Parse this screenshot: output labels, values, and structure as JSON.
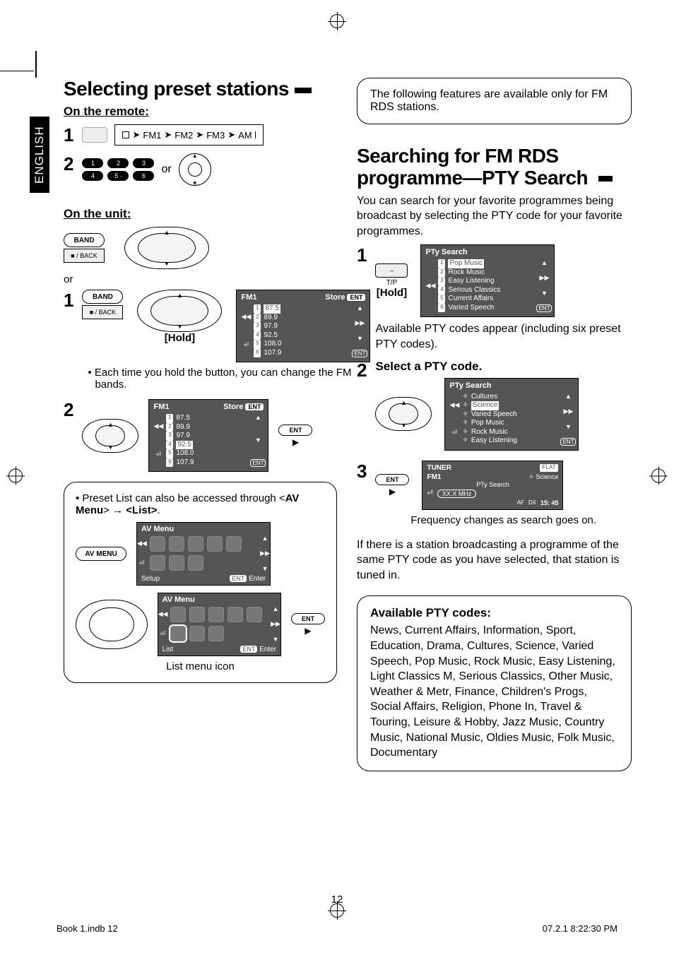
{
  "language_tab": "ENGLISH",
  "page_number": "12",
  "footer_left": "Book 1.indb   12",
  "footer_right": "07.2.1   8:22:30 PM",
  "left": {
    "title": "Selecting preset stations",
    "on_remote": "On the remote:",
    "on_unit": "On the unit:",
    "band_sequence": [
      "FM1",
      "FM2",
      "FM3",
      "AM"
    ],
    "or": "or",
    "band_btn": "BAND",
    "back_btn": "■ / BACK",
    "hold_label": "[Hold]",
    "step1_note": "Each time you hold the button, you can change the FM bands.",
    "screen_fm1": {
      "header_left": "FM1",
      "header_right": "Store",
      "header_ent": "ENT",
      "freqs": [
        "87.5",
        "89.9",
        "97.9",
        "92.5",
        "108.0",
        "107.9"
      ]
    },
    "ent_label": "ENT",
    "box_note_line1": "Preset List can also be accessed through <",
    "box_note_av": "AV Menu",
    "box_note_arrow": "→",
    "box_note_list": "<List>",
    "av_menu_title": "AV Menu",
    "av_menu_btn": "AV MENU",
    "setup_label": "Setup",
    "list_label": "List",
    "enter_label": "Enter",
    "list_caption": "List menu icon"
  },
  "right": {
    "info_box": "The following features are available only for FM RDS stations.",
    "title_line1": "Searching for FM RDS",
    "title_line2": "programme—PTY Search",
    "intro": "You can search for your favorite programmes being broadcast by selecting the PTY code for your favorite programmes.",
    "step1_hold": "[Hold]",
    "step1_tp": "T/P",
    "pty_title": "PTy Search",
    "preset_codes": [
      "Pop Music",
      "Rock Music",
      "Easy Listening",
      "Serious Classics",
      "Current Affairs",
      "Varied Speech"
    ],
    "step1_sub": "Available PTY codes appear (including six preset PTY codes).",
    "step2_title": "Select a PTY code.",
    "step2_codes_top": [
      "Cultures",
      "Science",
      "Varied Speech",
      "Pop Music",
      "Rock Music",
      "Easy Listening"
    ],
    "step3_tuner": "TUNER",
    "step3_flat": "FLAT",
    "step3_fm1": "FM1",
    "step3_sci": "Science",
    "step3_pty": "PTy Search",
    "step3_freq": "XX.X MHz",
    "step3_af": "AF",
    "step3_dx": "DX",
    "step3_time": "15: 45",
    "step3_caption": "Frequency changes as search goes on.",
    "result_text": "If there is a station broadcasting a programme of the same PTY code as you have selected, that station is tuned in.",
    "pty_box_title": "Available PTY codes:",
    "pty_box_body": "News, Current Affairs, Information, Sport, Education, Drama, Cultures, Science, Varied Speech, Pop Music, Rock Music, Easy Listening, Light Classics M, Serious Classics, Other Music, Weather & Metr, Finance, Children's Progs, Social Affairs, Religion, Phone In, Travel & Touring, Leisure & Hobby, Jazz Music, Country Music, National Music, Oldies Music, Folk Music, Documentary"
  }
}
